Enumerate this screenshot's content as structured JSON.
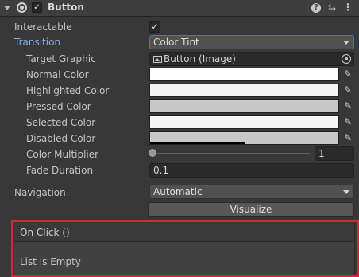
{
  "component": {
    "title": "Button",
    "enabled_check": "✓",
    "icons": [
      "foldout-arrow-icon",
      "button-component-icon",
      "help-icon",
      "presets-icon",
      "context-menu-icon"
    ]
  },
  "fields": {
    "interactable": {
      "label": "Interactable",
      "check": "✓"
    },
    "transition": {
      "label": "Transition",
      "value": "Color Tint"
    },
    "target_graphic": {
      "label": "Target Graphic",
      "value": "Button (Image)"
    },
    "normal_color": {
      "label": "Normal Color",
      "color": "#ffffff"
    },
    "highlighted_color": {
      "label": "Highlighted Color",
      "color": "#f5f5f5"
    },
    "pressed_color": {
      "label": "Pressed Color",
      "color": "#c8c8c8"
    },
    "selected_color": {
      "label": "Selected Color",
      "color": "#f5f5f5"
    },
    "disabled_color": {
      "label": "Disabled Color",
      "color": "#c8c8c8",
      "alpha_fraction": 0.5
    },
    "color_multiplier": {
      "label": "Color Multiplier",
      "value": "1",
      "slider_fraction": 0.0
    },
    "fade_duration": {
      "label": "Fade Duration",
      "value": "0.1"
    },
    "navigation": {
      "label": "Navigation",
      "value": "Automatic"
    }
  },
  "visualize_button": "Visualize",
  "on_click": {
    "title": "On Click ()",
    "empty_text": "List is Empty",
    "highlight_color": "#d9233b"
  },
  "colors": {
    "panel_bg": "#383838",
    "accent_blue": "#7fb0ec"
  }
}
